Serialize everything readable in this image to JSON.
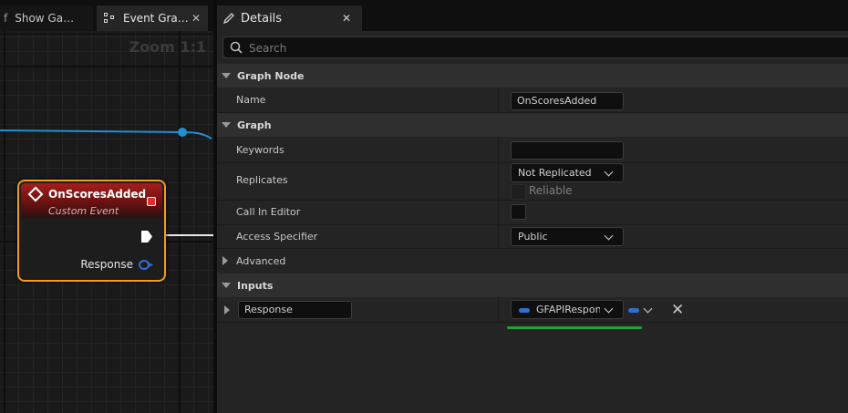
{
  "graph_editor": {
    "tabs": [
      {
        "label": "Show Ga…",
        "leading_glyph": "f",
        "icon": "graph-icon"
      },
      {
        "label": "Event Gra…",
        "icon": "graph-icon",
        "close": "✕"
      }
    ],
    "zoom_label": "Zoom 1:1",
    "event_node": {
      "title": "OnScoresAdded",
      "subtitle": "Custom Event",
      "output_pin_label": "Response"
    },
    "colors": {
      "node_border": "#f19c1c",
      "node_header": "#a51e1e",
      "wire": "#1f8fd6",
      "struct_pin": "#2f6fd4"
    }
  },
  "details": {
    "tab_label": "Details",
    "tab_close": "✕",
    "search": {
      "placeholder": "Search",
      "value": ""
    },
    "graph_node_section": {
      "title": "Graph Node",
      "name_label": "Name",
      "name_value": "OnScoresAdded"
    },
    "graph_section": {
      "title": "Graph",
      "keywords_label": "Keywords",
      "keywords_value": "",
      "replicates_label": "Replicates",
      "replicates_value": "Not Replicated",
      "reliable_label": "Reliable",
      "call_in_editor_label": "Call In Editor",
      "access_specifier_label": "Access Specifier",
      "access_specifier_value": "Public"
    },
    "advanced_section": {
      "title": "Advanced"
    },
    "inputs_section": {
      "title": "Inputs",
      "param_name": "Response",
      "param_type": "GFAPIResponse",
      "remove_label": "✕"
    }
  }
}
